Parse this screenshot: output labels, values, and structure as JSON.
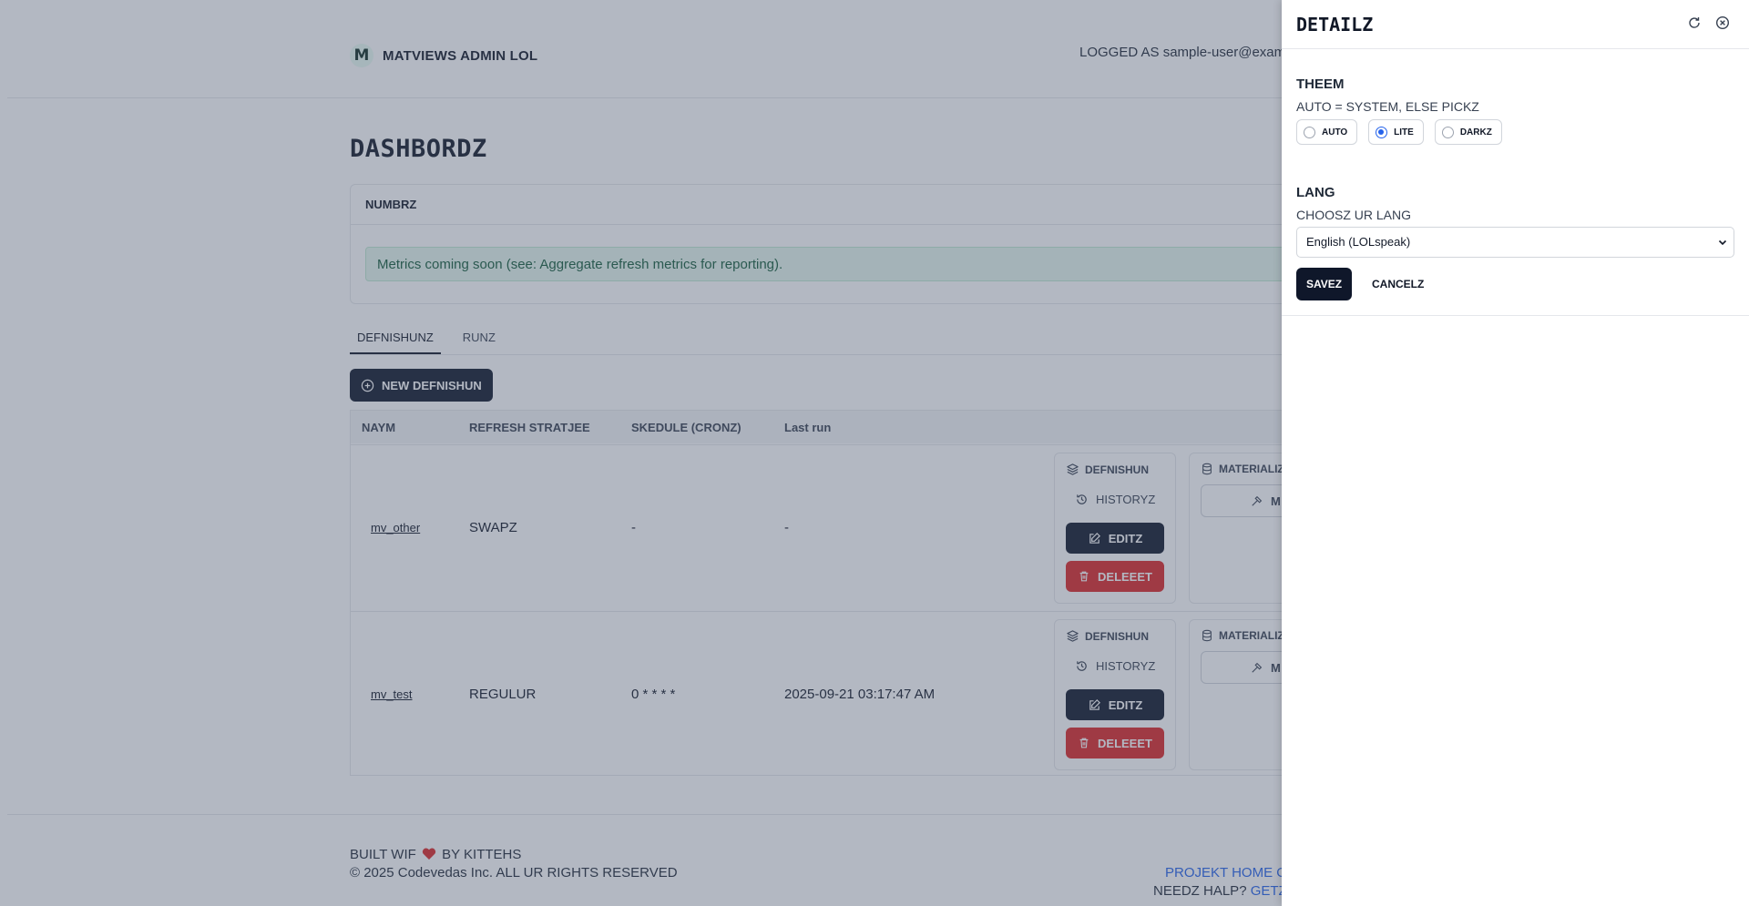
{
  "header": {
    "brand_logo": "M",
    "brand_name": "MATVIEWS ADMIN LOL",
    "logged_as": "LOGGED AS sample-user@example.com"
  },
  "main": {
    "title": "DASHBORDZ",
    "metrics_card": {
      "title": "NUMBRZ",
      "alert": "Metrics coming soon (see: Aggregate refresh metrics for reporting)."
    },
    "tabs": [
      {
        "label": "DEFNISHUNZ",
        "active": true
      },
      {
        "label": "RUNZ",
        "active": false
      }
    ],
    "new_button": "NEW DEFNISHUN",
    "table": {
      "columns": [
        "NAYM",
        "REFRESH STRATJEE",
        "SKEDULE (CRONZ)",
        "Last run"
      ],
      "rows": [
        {
          "name": "mv_other",
          "strategy": "SWAPZ",
          "schedule": "-",
          "last_run": "-",
          "definition_label": "DEFNISHUN",
          "history_label": "HISTORYZ",
          "edit_label": "EDITZ",
          "delete_label": "DELEEET",
          "materialize_label": "MATERIALIZ",
          "materialize_button": "M"
        },
        {
          "name": "mv_test",
          "strategy": "REGULUR",
          "schedule": "0 * * * *",
          "last_run": "2025-09-21 03:17:47 AM",
          "definition_label": "DEFNISHUN",
          "history_label": "HISTORYZ",
          "edit_label": "EDITZ",
          "delete_label": "DELEEET",
          "materialize_label": "MATERIALIZ",
          "materialize_button": "M"
        }
      ]
    }
  },
  "footer": {
    "built_prefix": "BUILT WIF",
    "built_suffix": "BY KITTEHS",
    "copyright": "© 2025 Codevedas Inc. ALL UR RIGHTS RESERVED",
    "project_link": "PROJEKT HOME O",
    "help_text": "NEEDZ HALP?",
    "help_link": "GETZ"
  },
  "panel": {
    "title": "DETAILZ",
    "theme": {
      "title": "THEEM",
      "subtitle": "AUTO = SYSTEM, ELSE PICKZ",
      "options": [
        {
          "label": "AUTO",
          "selected": false
        },
        {
          "label": "LITE",
          "selected": true
        },
        {
          "label": "DARKZ",
          "selected": false
        }
      ]
    },
    "lang": {
      "title": "LANG",
      "subtitle": "CHOOSZ UR LANG",
      "selected": "English (LOLspeak)"
    },
    "save_label": "SAVEZ",
    "cancel_label": "CANCELZ"
  },
  "colors": {
    "primary": "#0f172a",
    "danger": "#dc2626",
    "link": "#2563eb",
    "radio_accent": "#2563eb",
    "alert_bg": "#e6f7ee"
  }
}
